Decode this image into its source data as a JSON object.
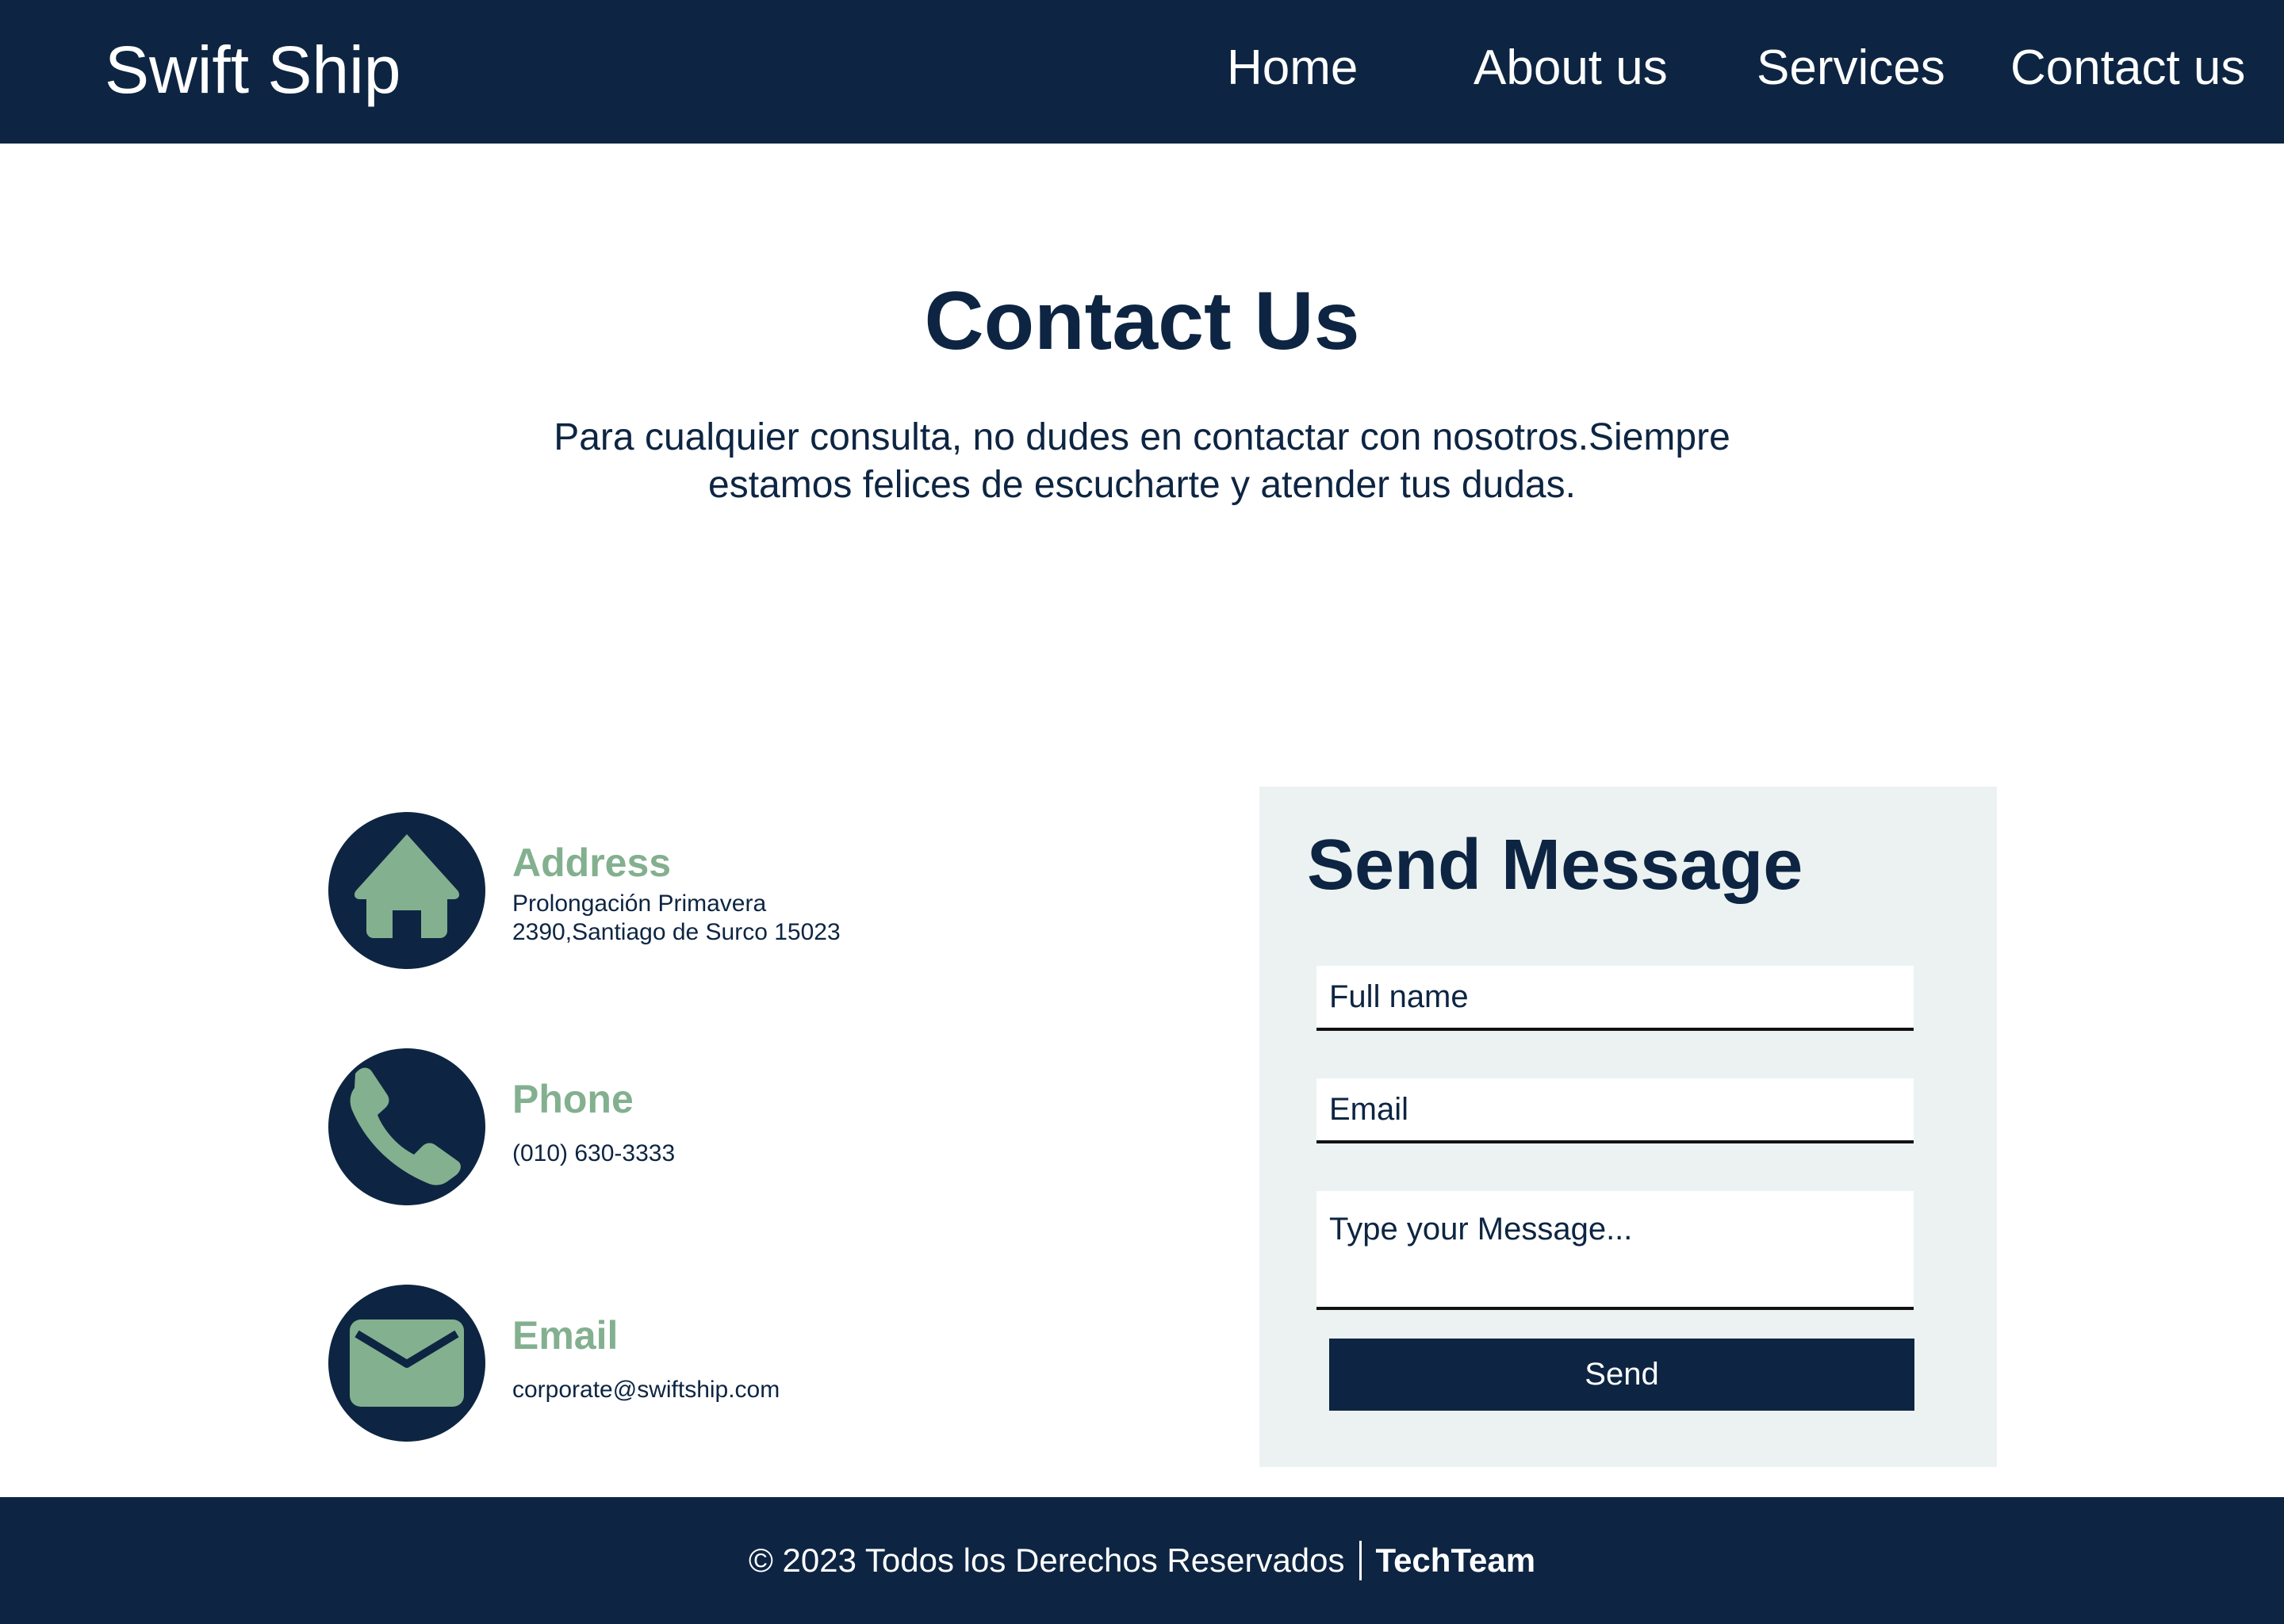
{
  "header": {
    "brand": "Swift Ship",
    "nav": [
      "Home",
      "About us",
      "Services",
      "Contact us"
    ]
  },
  "main": {
    "title": "Contact Us",
    "intro_line1": "Para cualquier consulta, no dudes en contactar con nosotros.Siempre",
    "intro_line2": "estamos felices de escucharte y atender tus dudas."
  },
  "info": {
    "address": {
      "label": "Address",
      "line1": "Prolongación Primavera",
      "line2": "2390,Santiago de Surco 15023",
      "icon": "home-icon"
    },
    "phone": {
      "label": "Phone",
      "value": "(010) 630-3333",
      "icon": "phone-icon"
    },
    "email": {
      "label": "Email",
      "value": "corporate@swiftship.com",
      "icon": "envelope-icon"
    }
  },
  "form": {
    "title": "Send Message",
    "fullname_placeholder": "Full name",
    "email_placeholder": "Email",
    "message_placeholder": "Type your Message...",
    "send_label": "Send"
  },
  "footer": {
    "copyright": "© 2023 Todos los Derechos Reservados",
    "team": "TechTeam"
  },
  "colors": {
    "primary": "#0d2542",
    "accent": "#83b08f",
    "panel": "#ecf2f2"
  }
}
